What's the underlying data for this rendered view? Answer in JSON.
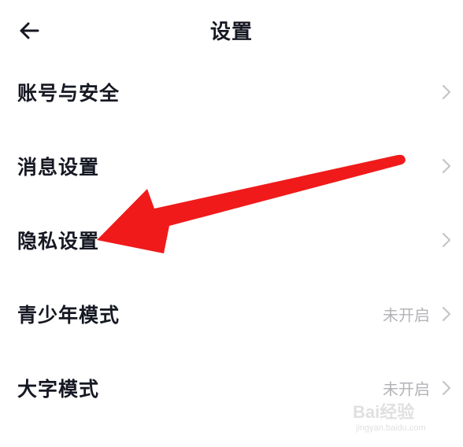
{
  "header": {
    "title": "设置",
    "back_icon": "arrow-left-icon"
  },
  "settings": [
    {
      "label": "账号与安全",
      "value": ""
    },
    {
      "label": "消息设置",
      "value": ""
    },
    {
      "label": "隐私设置",
      "value": ""
    },
    {
      "label": "青少年模式",
      "value": "未开启"
    },
    {
      "label": "大字模式",
      "value": "未开启"
    }
  ],
  "annotation": {
    "color": "#f01a1a",
    "points_to": "隐私设置"
  },
  "watermark": {
    "main": "Bai经验",
    "sub": "jingyan.baidu.com"
  }
}
